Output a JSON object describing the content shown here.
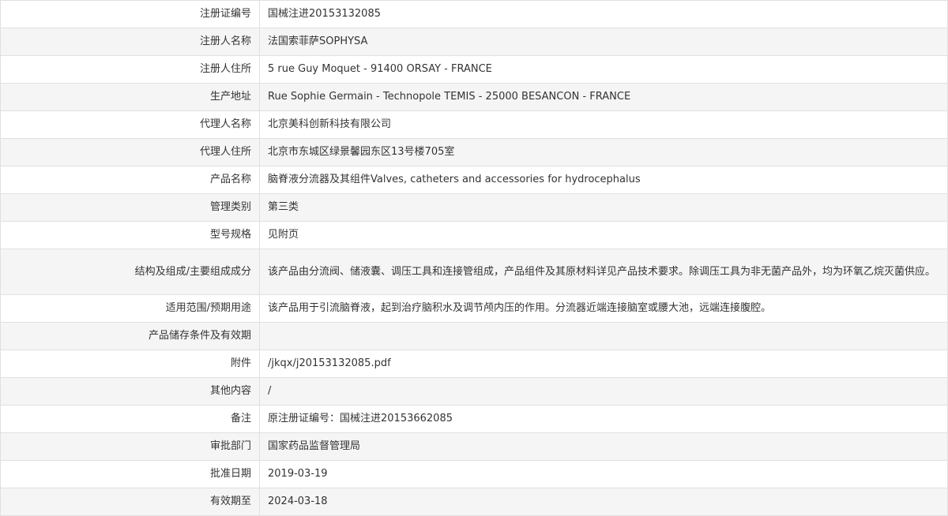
{
  "rows": [
    {
      "label": "注册证编号",
      "value": "国械注进20153132085"
    },
    {
      "label": "注册人名称",
      "value": "法国索菲萨SOPHYSA"
    },
    {
      "label": "注册人住所",
      "value": "5 rue Guy Moquet - 91400 ORSAY - FRANCE"
    },
    {
      "label": "生产地址",
      "value": "Rue Sophie Germain - Technopole TEMIS - 25000 BESANCON - FRANCE"
    },
    {
      "label": "代理人名称",
      "value": "北京美科创新科技有限公司"
    },
    {
      "label": "代理人住所",
      "value": "北京市东城区绿景馨园东区13号楼705室"
    },
    {
      "label": "产品名称",
      "value": "脑脊液分流器及其组件Valves, catheters and accessories for hydrocephalus"
    },
    {
      "label": "管理类别",
      "value": "第三类"
    },
    {
      "label": "型号规格",
      "value": "见附页"
    },
    {
      "label": "结构及组成/主要组成成分",
      "value": "该产品由分流阀、储液囊、调压工具和连接管组成，产品组件及其原材料详见产品技术要求。除调压工具为非无菌产品外，均为环氧乙烷灭菌供应。"
    },
    {
      "label": "适用范围/预期用途",
      "value": "该产品用于引流脑脊液，起到治疗脑积水及调节颅内压的作用。分流器近端连接脑室或腰大池，远端连接腹腔。"
    },
    {
      "label": "产品储存条件及有效期",
      "value": ""
    },
    {
      "label": "附件",
      "value": "/jkqx/j20153132085.pdf"
    },
    {
      "label": "其他内容",
      "value": "/"
    },
    {
      "label": "备注",
      "value": "原注册证编号：国械注进20153662085"
    },
    {
      "label": "审批部门",
      "value": "国家药品监督管理局"
    },
    {
      "label": "批准日期",
      "value": "2019-03-19"
    },
    {
      "label": "有效期至",
      "value": "2024-03-18"
    }
  ]
}
